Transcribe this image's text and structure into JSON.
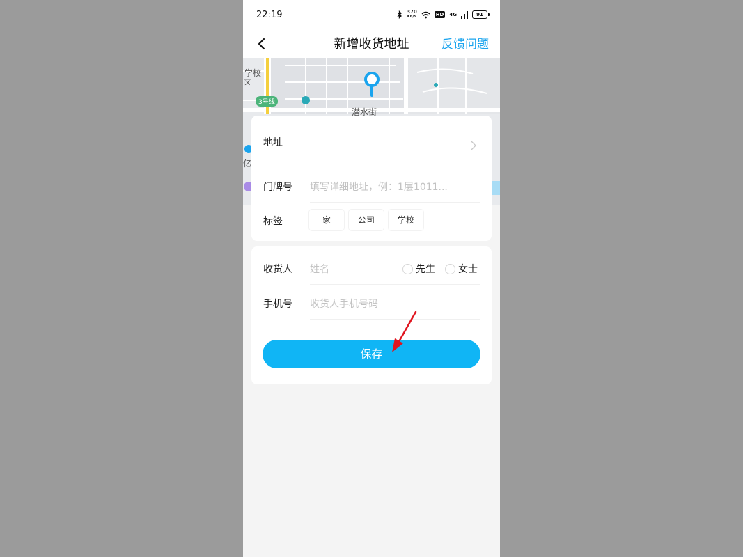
{
  "status_bar": {
    "time": "22:19",
    "net_speed_value": "370",
    "net_speed_unit": "KB/S",
    "hd": "HD",
    "network": "4G",
    "battery": "91"
  },
  "nav": {
    "title": "新增收货地址",
    "feedback": "反馈问题"
  },
  "map": {
    "labels": {
      "school_line1": "学校",
      "school_line2": "区",
      "metro": "3号线",
      "street": "潜水街",
      "yi": "亿"
    }
  },
  "address_form": {
    "address_label": "地址",
    "house_label": "门牌号",
    "house_placeholder": "填写详细地址，例：1层1011...",
    "tag_label": "标签",
    "tags": [
      "家",
      "公司",
      "学校"
    ]
  },
  "receiver_form": {
    "name_label": "收货人",
    "name_placeholder": "姓名",
    "gender_options": [
      "先生",
      "女士"
    ],
    "phone_label": "手机号",
    "phone_placeholder": "收货人手机号码",
    "save_label": "保存"
  },
  "colors": {
    "accent": "#10b5f5",
    "link": "#1aa4ee",
    "annotation": "#e0141e"
  }
}
